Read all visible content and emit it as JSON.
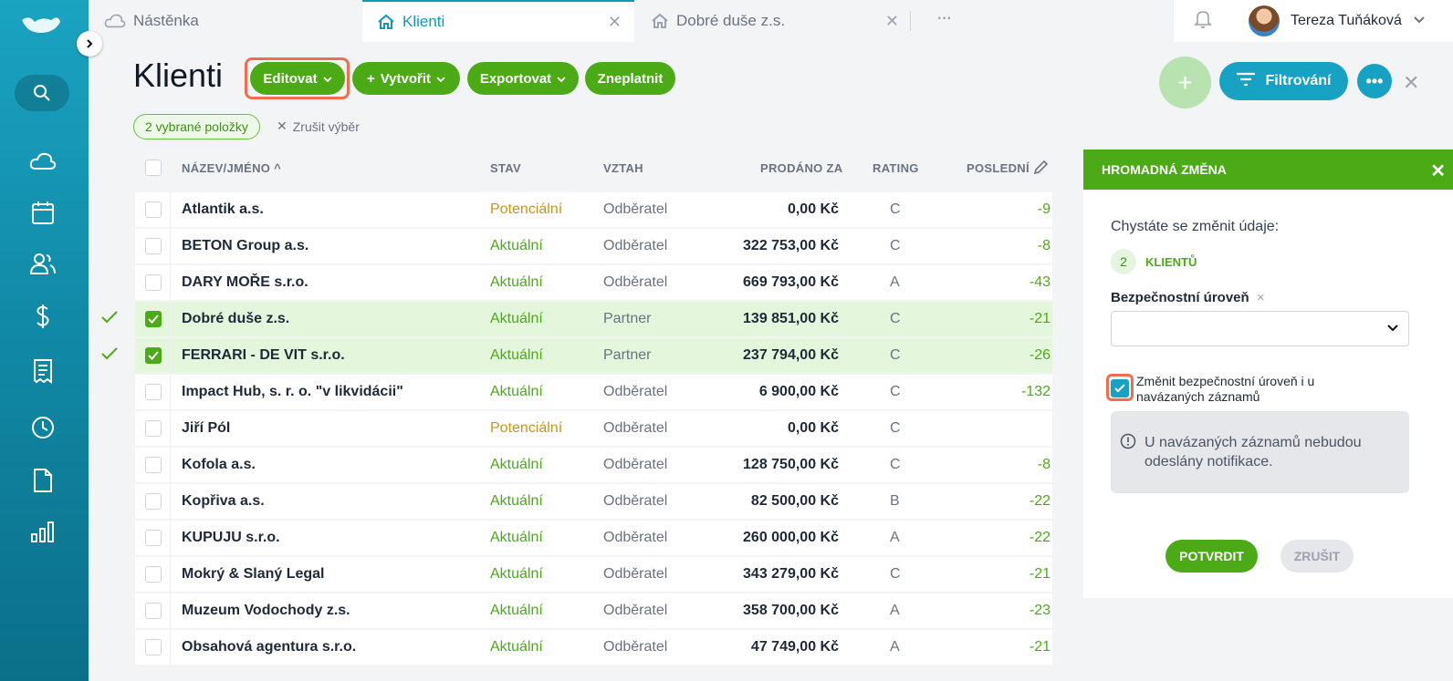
{
  "tabs": [
    {
      "label": "Nástěnka",
      "icon": "cloud-icon"
    },
    {
      "label": "Klienti",
      "icon": "home-icon"
    },
    {
      "label": "Dobré duše z.s.",
      "icon": "home-icon"
    }
  ],
  "tabs_more": "···",
  "user": {
    "name": "Tereza Tuňáková"
  },
  "page": {
    "title": "Klienti"
  },
  "toolbar": {
    "edit": "Editovat",
    "create": "Vytvořit",
    "export": "Exportovat",
    "invalidate": "Zneplatnit",
    "add": "+",
    "filter": "Filtrování",
    "more": "•••",
    "close": "✕"
  },
  "selection": {
    "chip": "2 vybrané položky",
    "clear": "Zrušit výběr"
  },
  "table": {
    "headers": {
      "name": "NÁZEV/JMÉNO",
      "stav": "STAV",
      "vztah": "VZTAH",
      "prodano": "PRODÁNO ZA",
      "rating": "RATING",
      "posledni": "POSLEDNÍ"
    },
    "rows": [
      {
        "name": "Atlantik a.s.",
        "stav": "Potenciální",
        "vztah": "Odběratel",
        "prodano": "0,00 Kč",
        "rating": "C",
        "posledni": "-9",
        "selected": false
      },
      {
        "name": "BETON Group a.s.",
        "stav": "Aktuální",
        "vztah": "Odběratel",
        "prodano": "322 753,00 Kč",
        "rating": "C",
        "posledni": "-8",
        "selected": false
      },
      {
        "name": "DARY MOŘE s.r.o.",
        "stav": "Aktuální",
        "vztah": "Odběratel",
        "prodano": "669 793,00 Kč",
        "rating": "A",
        "posledni": "-43",
        "selected": false
      },
      {
        "name": "Dobré duše z.s.",
        "stav": "Aktuální",
        "vztah": "Partner",
        "prodano": "139 851,00 Kč",
        "rating": "C",
        "posledni": "-21",
        "selected": true
      },
      {
        "name": "FERRARI - DE VIT s.r.o.",
        "stav": "Aktuální",
        "vztah": "Partner",
        "prodano": "237 794,00 Kč",
        "rating": "C",
        "posledni": "-26",
        "selected": true
      },
      {
        "name": "Impact Hub, s. r. o. \"v likvidácii\"",
        "stav": "Aktuální",
        "vztah": "Odběratel",
        "prodano": "6 900,00 Kč",
        "rating": "C",
        "posledni": "-132",
        "selected": false
      },
      {
        "name": "Jiří Pól",
        "stav": "Potenciální",
        "vztah": "Odběratel",
        "prodano": "0,00 Kč",
        "rating": "C",
        "posledni": "",
        "selected": false
      },
      {
        "name": "Kofola a.s.",
        "stav": "Aktuální",
        "vztah": "Odběratel",
        "prodano": "128 750,00 Kč",
        "rating": "C",
        "posledni": "-8",
        "selected": false
      },
      {
        "name": "Kopřiva a.s.",
        "stav": "Aktuální",
        "vztah": "Odběratel",
        "prodano": "82 500,00 Kč",
        "rating": "B",
        "posledni": "-22",
        "selected": false
      },
      {
        "name": "KUPUJU s.r.o.",
        "stav": "Aktuální",
        "vztah": "Odběratel",
        "prodano": "260 000,00 Kč",
        "rating": "A",
        "posledni": "-22",
        "selected": false
      },
      {
        "name": "Mokrý & Slaný Legal",
        "stav": "Aktuální",
        "vztah": "Odběratel",
        "prodano": "343 279,00 Kč",
        "rating": "C",
        "posledni": "-21",
        "selected": false
      },
      {
        "name": "Muzeum Vodochody z.s.",
        "stav": "Aktuální",
        "vztah": "Odběratel",
        "prodano": "358 700,00 Kč",
        "rating": "A",
        "posledni": "-23",
        "selected": false
      },
      {
        "name": "Obsahová agentura s.r.o.",
        "stav": "Aktuální",
        "vztah": "Odběratel",
        "prodano": "47 749,00 Kč",
        "rating": "A",
        "posledni": "-21",
        "selected": false
      }
    ]
  },
  "panel": {
    "title": "HROMADNÁ ZMĚNA",
    "close": "✕",
    "intro": "Chystáte se změnit údaje:",
    "count": "2",
    "count_label": "KLIENTŮ",
    "field_label": "Bezpečnostní úroveň",
    "field_remove": "×",
    "checkbox_label": "Změnit bezpečnostní úroveň i u navázaných záznamů",
    "notice": "U navázaných záznamů nebudou odeslány notifikace.",
    "confirm": "POTVRDIT",
    "cancel": "ZRUŠIT"
  },
  "colors": {
    "green": "#4caa16",
    "teal": "#17a1c2",
    "highlight": "#f06d4f"
  }
}
